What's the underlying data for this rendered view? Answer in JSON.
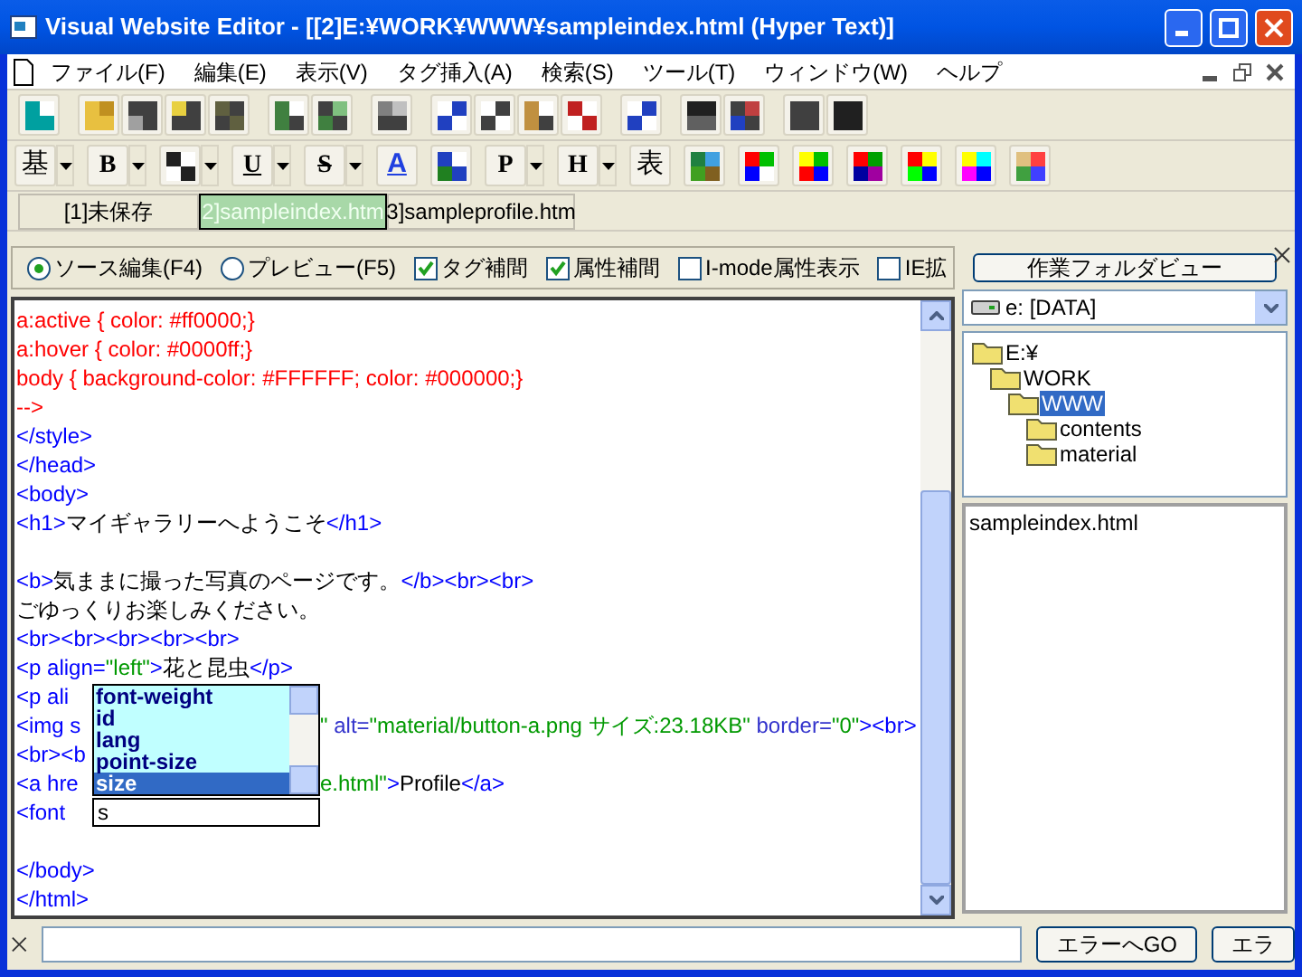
{
  "window": {
    "title": "Visual Website Editor - [[2]E:¥WORK¥WWW¥sampleindex.html (Hyper Text)]"
  },
  "menu": [
    "ファイル(F)",
    "編集(E)",
    "表示(V)",
    "タグ挿入(A)",
    "検索(S)",
    "ツール(T)",
    "ウィンドウ(W)",
    "ヘルプ"
  ],
  "format_toolbar": [
    {
      "kind": "letter",
      "label": "基",
      "dropdown": true
    },
    {
      "kind": "letter",
      "label": "B",
      "dropdown": true
    },
    {
      "kind": "icon",
      "dropdown": true
    },
    {
      "kind": "letter",
      "label": "U",
      "dropdown": true
    },
    {
      "kind": "letter",
      "label": "S",
      "dropdown": true
    },
    {
      "kind": "letter",
      "label": "A",
      "dropdown": false
    },
    {
      "kind": "icon",
      "dropdown": false
    },
    {
      "kind": "letter",
      "label": "P",
      "dropdown": true
    },
    {
      "kind": "letter",
      "label": "H",
      "dropdown": true
    },
    {
      "kind": "letter",
      "label": "表",
      "dropdown": false
    },
    {
      "kind": "icon",
      "dropdown": false
    },
    {
      "kind": "icon",
      "dropdown": false
    },
    {
      "kind": "icon",
      "dropdown": false
    },
    {
      "kind": "icon",
      "dropdown": false
    },
    {
      "kind": "icon",
      "dropdown": false
    },
    {
      "kind": "icon",
      "dropdown": false
    },
    {
      "kind": "icon",
      "dropdown": false
    }
  ],
  "tabs": [
    {
      "label": "[1]未保存",
      "selected": false
    },
    {
      "label": "2]sampleindex.htm",
      "selected": true
    },
    {
      "label": "3]sampleprofile.htm",
      "selected": false
    }
  ],
  "options": [
    {
      "kind": "radio",
      "label": "ソース編集(F4)",
      "selected": true
    },
    {
      "kind": "radio",
      "label": "プレビュー(F5)",
      "selected": false
    },
    {
      "kind": "checkbox",
      "label": "タグ補間",
      "checked": true
    },
    {
      "kind": "checkbox",
      "label": "属性補間",
      "checked": true
    },
    {
      "kind": "checkbox",
      "label": "I-mode属性表示",
      "checked": false
    },
    {
      "kind": "checkbox",
      "label": "IE拡",
      "checked": false
    }
  ],
  "code_lines": [
    {
      "left": [
        {
          "kind": "css",
          "text": "a:active { color: #ff0000;}"
        }
      ]
    },
    {
      "left": [
        {
          "kind": "css",
          "text": "a:hover { color: #0000ff;}"
        }
      ]
    },
    {
      "left": [
        {
          "kind": "css",
          "text": "body { background-color: #FFFFFF; color: #000000;}"
        }
      ]
    },
    {
      "left": [
        {
          "kind": "css",
          "text": "-->"
        }
      ]
    },
    {
      "left": [
        {
          "kind": "tag",
          "text": "</style>"
        }
      ]
    },
    {
      "left": [
        {
          "kind": "tag",
          "text": "</head>"
        }
      ]
    },
    {
      "left": [
        {
          "kind": "tag",
          "text": "<body>"
        }
      ]
    },
    {
      "left": [
        {
          "kind": "tag",
          "text": "<h1>"
        },
        {
          "kind": "text",
          "text": "マイギャラリーへようこそ"
        },
        {
          "kind": "tag",
          "text": "</h1>"
        }
      ]
    },
    {
      "kind": "blank"
    },
    {
      "left": [
        {
          "kind": "tag",
          "text": "<b>"
        },
        {
          "kind": "text",
          "text": "気ままに撮った写真のページです。"
        },
        {
          "kind": "tag",
          "text": "</b><br><br>"
        }
      ]
    },
    {
      "left": [
        {
          "kind": "text",
          "text": "ごゆっくりお楽しみください。"
        }
      ]
    },
    {
      "left": [
        {
          "kind": "tag",
          "text": "<br><br><br><br><br>"
        }
      ]
    },
    {
      "left": [
        {
          "kind": "tag",
          "text": "<p align="
        },
        {
          "kind": "value",
          "text": "\"left\""
        },
        {
          "kind": "tag",
          "text": ">"
        },
        {
          "kind": "text",
          "text": "花と昆虫"
        },
        {
          "kind": "tag",
          "text": "</p>"
        }
      ]
    },
    {
      "left": [
        {
          "kind": "tag",
          "text": "<p ali"
        }
      ]
    },
    {
      "left": [
        {
          "kind": "tag",
          "text": "<img s"
        }
      ],
      "right": [
        {
          "kind": "value",
          "text": "\""
        },
        {
          "kind": "attr",
          "text": " alt="
        },
        {
          "kind": "value",
          "text": "\"material/button-a.png サイズ:23.18KB\""
        },
        {
          "kind": "attr",
          "text": " border="
        },
        {
          "kind": "value",
          "text": "\"0\""
        },
        {
          "kind": "tag",
          "text": "><br>"
        }
      ]
    },
    {
      "left": [
        {
          "kind": "tag",
          "text": "<br><b"
        }
      ]
    },
    {
      "left": [
        {
          "kind": "tag",
          "text": "<a hre"
        }
      ],
      "right": [
        {
          "kind": "value",
          "text": "e.html\""
        },
        {
          "kind": "tag",
          "text": ">"
        },
        {
          "kind": "text",
          "text": "Profile"
        },
        {
          "kind": "tag",
          "text": "</a>"
        }
      ]
    },
    {
      "left": [
        {
          "kind": "tag",
          "text": "<font "
        }
      ],
      "input": true
    },
    {
      "kind": "blank"
    },
    {
      "left": [
        {
          "kind": "tag",
          "text": "</body>"
        }
      ]
    },
    {
      "left": [
        {
          "kind": "tag",
          "text": "</html>"
        }
      ]
    }
  ],
  "completion": {
    "items": [
      {
        "label": "font-weight",
        "selected": false
      },
      {
        "label": "id",
        "selected": false
      },
      {
        "label": "lang",
        "selected": false
      },
      {
        "label": "point-size",
        "selected": false
      },
      {
        "label": "size",
        "selected": true
      }
    ],
    "value": "s"
  },
  "side_panel": {
    "button": "作業フォルダビュー",
    "drive": "e: [DATA]",
    "tree": [
      {
        "label": "E:¥",
        "selected": false,
        "children": [
          {
            "label": "WORK",
            "selected": false,
            "children": [
              {
                "label": "WWW",
                "selected": true,
                "children": [
                  {
                    "label": "contents",
                    "selected": false
                  },
                  {
                    "label": "material",
                    "selected": false
                  }
                ]
              }
            ]
          }
        ]
      }
    ],
    "files": [
      "sampleindex.html"
    ]
  },
  "bottom": {
    "buttons": [
      "エラーへGO",
      "エラ"
    ]
  }
}
